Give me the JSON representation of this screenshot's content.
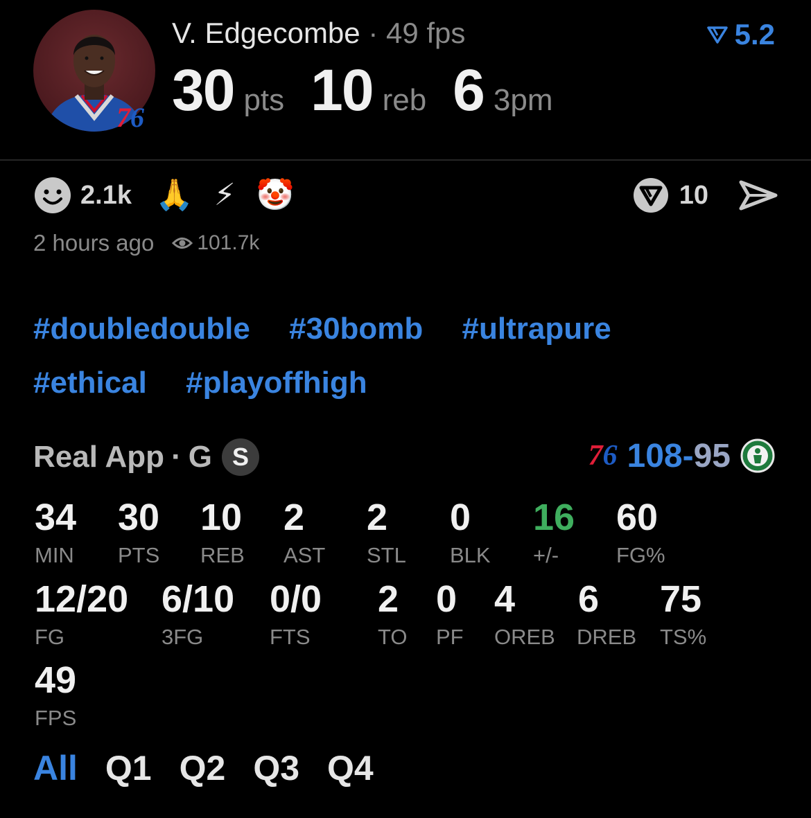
{
  "header": {
    "player_name": "V. Edgecombe",
    "separator": "·",
    "fps_text": "49 fps",
    "rating": "5.2",
    "team_badge": {
      "seven": "7",
      "six": "6"
    },
    "big_stats": [
      {
        "value": "30",
        "unit": "pts"
      },
      {
        "value": "10",
        "unit": "reb"
      },
      {
        "value": "6",
        "unit": "3pm"
      }
    ]
  },
  "reactions": {
    "smiley_count": "2.1k",
    "emojis": [
      "🙏",
      "⚡",
      "🤡"
    ],
    "comment_count": "10",
    "time_ago": "2 hours ago",
    "views": "101.7k"
  },
  "hashtags": [
    "#doubledouble",
    "#30bomb",
    "#ultrapure",
    "#ethical",
    "#playoffhigh"
  ],
  "game": {
    "source": "Real App",
    "separator": "·",
    "position": "G",
    "badge": "S",
    "home_badge": {
      "seven": "7",
      "six": "6"
    },
    "home_score": "108",
    "dash": "-",
    "away_score": "95"
  },
  "stats": [
    {
      "value": "34",
      "label": "MIN"
    },
    {
      "value": "30",
      "label": "PTS"
    },
    {
      "value": "10",
      "label": "REB"
    },
    {
      "value": "2",
      "label": "AST"
    },
    {
      "value": "2",
      "label": "STL"
    },
    {
      "value": "0",
      "label": "BLK"
    },
    {
      "value": "16",
      "label": "+/-"
    },
    {
      "value": "60",
      "label": "FG%"
    },
    {
      "value": "12/20",
      "label": "FG"
    },
    {
      "value": "6/10",
      "label": "3FG"
    },
    {
      "value": "0/0",
      "label": "FTS"
    },
    {
      "value": "2",
      "label": "TO"
    },
    {
      "value": "0",
      "label": "PF"
    },
    {
      "value": "4",
      "label": "OREB"
    },
    {
      "value": "6",
      "label": "DREB"
    },
    {
      "value": "75",
      "label": "TS%"
    },
    {
      "value": "49",
      "label": "FPS"
    }
  ],
  "quarters": [
    "All",
    "Q1",
    "Q2",
    "Q3",
    "Q4"
  ],
  "colors": {
    "accent_blue": "#3a84e0",
    "positive_green": "#3fae5e",
    "team_red": "#e01e38",
    "team_blue": "#1d5bc4",
    "muted": "#8a8a8a"
  },
  "icons": {
    "rating": "rating-logo-icon",
    "reaction": "smiley-icon",
    "comment": "comment-logo-icon",
    "share": "send-icon",
    "views": "eye-icon",
    "away_team": "celtics-logo-icon"
  }
}
